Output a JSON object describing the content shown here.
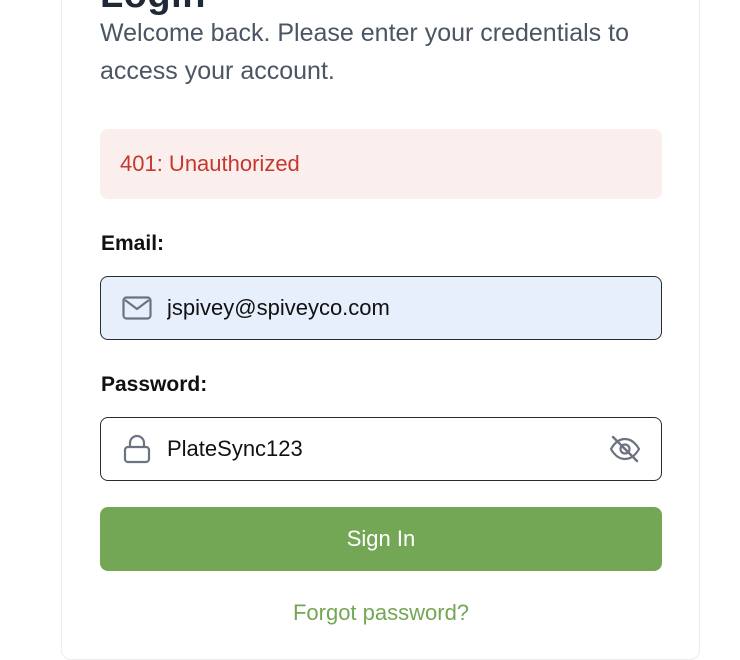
{
  "header": {
    "title": "Login",
    "subtitle": "Welcome back. Please enter your credentials to access your account."
  },
  "alert": {
    "message": "401: Unauthorized",
    "color": "#c6382f",
    "background": "#fbefed"
  },
  "form": {
    "email": {
      "label": "Email:",
      "value": "jspivey@spiveyco.com",
      "icon": "mail-icon"
    },
    "password": {
      "label": "Password:",
      "value": "PlateSync123",
      "icon": "lock-icon",
      "toggle_icon": "eye-off-icon"
    },
    "submit_label": "Sign In",
    "forgot_label": "Forgot password?"
  },
  "colors": {
    "accent": "#74a755",
    "email_field_bg": "#e8effc"
  }
}
